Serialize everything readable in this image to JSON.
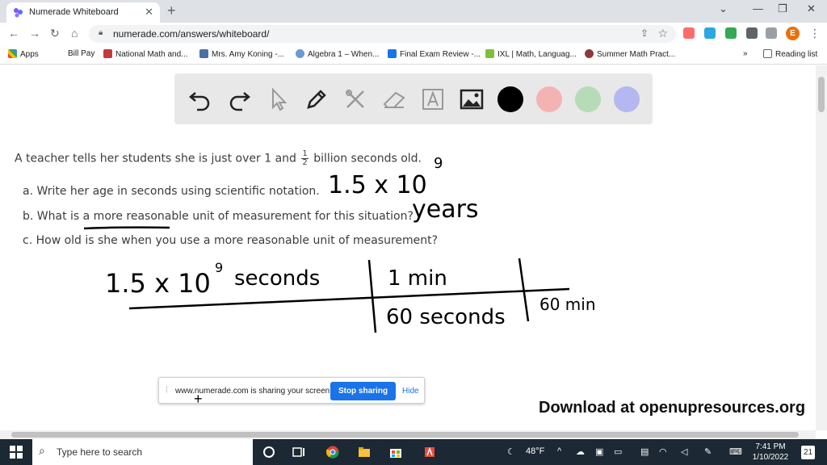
{
  "browser": {
    "tab_title": "Numerade Whiteboard",
    "url": "numerade.com/answers/whiteboard/",
    "avatar_letter": "E",
    "bookmarks": [
      "Apps",
      "Bill Pay",
      "National Math and...",
      "Mrs. Amy Koning -...",
      "Algebra 1 – When...",
      "Final Exam Review -...",
      "IXL | Math, Languag...",
      "Summer Math Pract..."
    ],
    "reading_list": "Reading list"
  },
  "toolbar": {
    "colors": [
      "#000000",
      "#f4b3b3",
      "#b6dbb6",
      "#b4b7f0"
    ]
  },
  "problem": {
    "intro_prefix": "A teacher tells her students she is just over 1 and",
    "frac_num": "1",
    "frac_den": "2",
    "intro_suffix": "billion seconds old.",
    "a": "a. Write her age in seconds using scientific notation.",
    "b": "b. What is a more reasonable unit of measurement for this situation?",
    "c": "c. How old is she when you use a more reasonable unit of measurement?"
  },
  "handwriting": {
    "answer_a": "1.5 x 10",
    "answer_a_exp": "9",
    "years": "years",
    "numerator": "1.5 x 10",
    "numerator_exp": "9",
    "numerator_unit": "seconds",
    "factor1_top": "1 min",
    "factor1_bottom": "60 seconds",
    "factor2_bottom": "60 min"
  },
  "share_banner": {
    "message": "www.numerade.com is sharing your screen.",
    "stop": "Stop sharing",
    "hide": "Hide"
  },
  "watermark": "Download at openupresources.org",
  "taskbar": {
    "search_placeholder": "Type here to search",
    "weather": "48°F",
    "time": "7:41 PM",
    "date": "1/10/2022",
    "notifications": "21"
  }
}
